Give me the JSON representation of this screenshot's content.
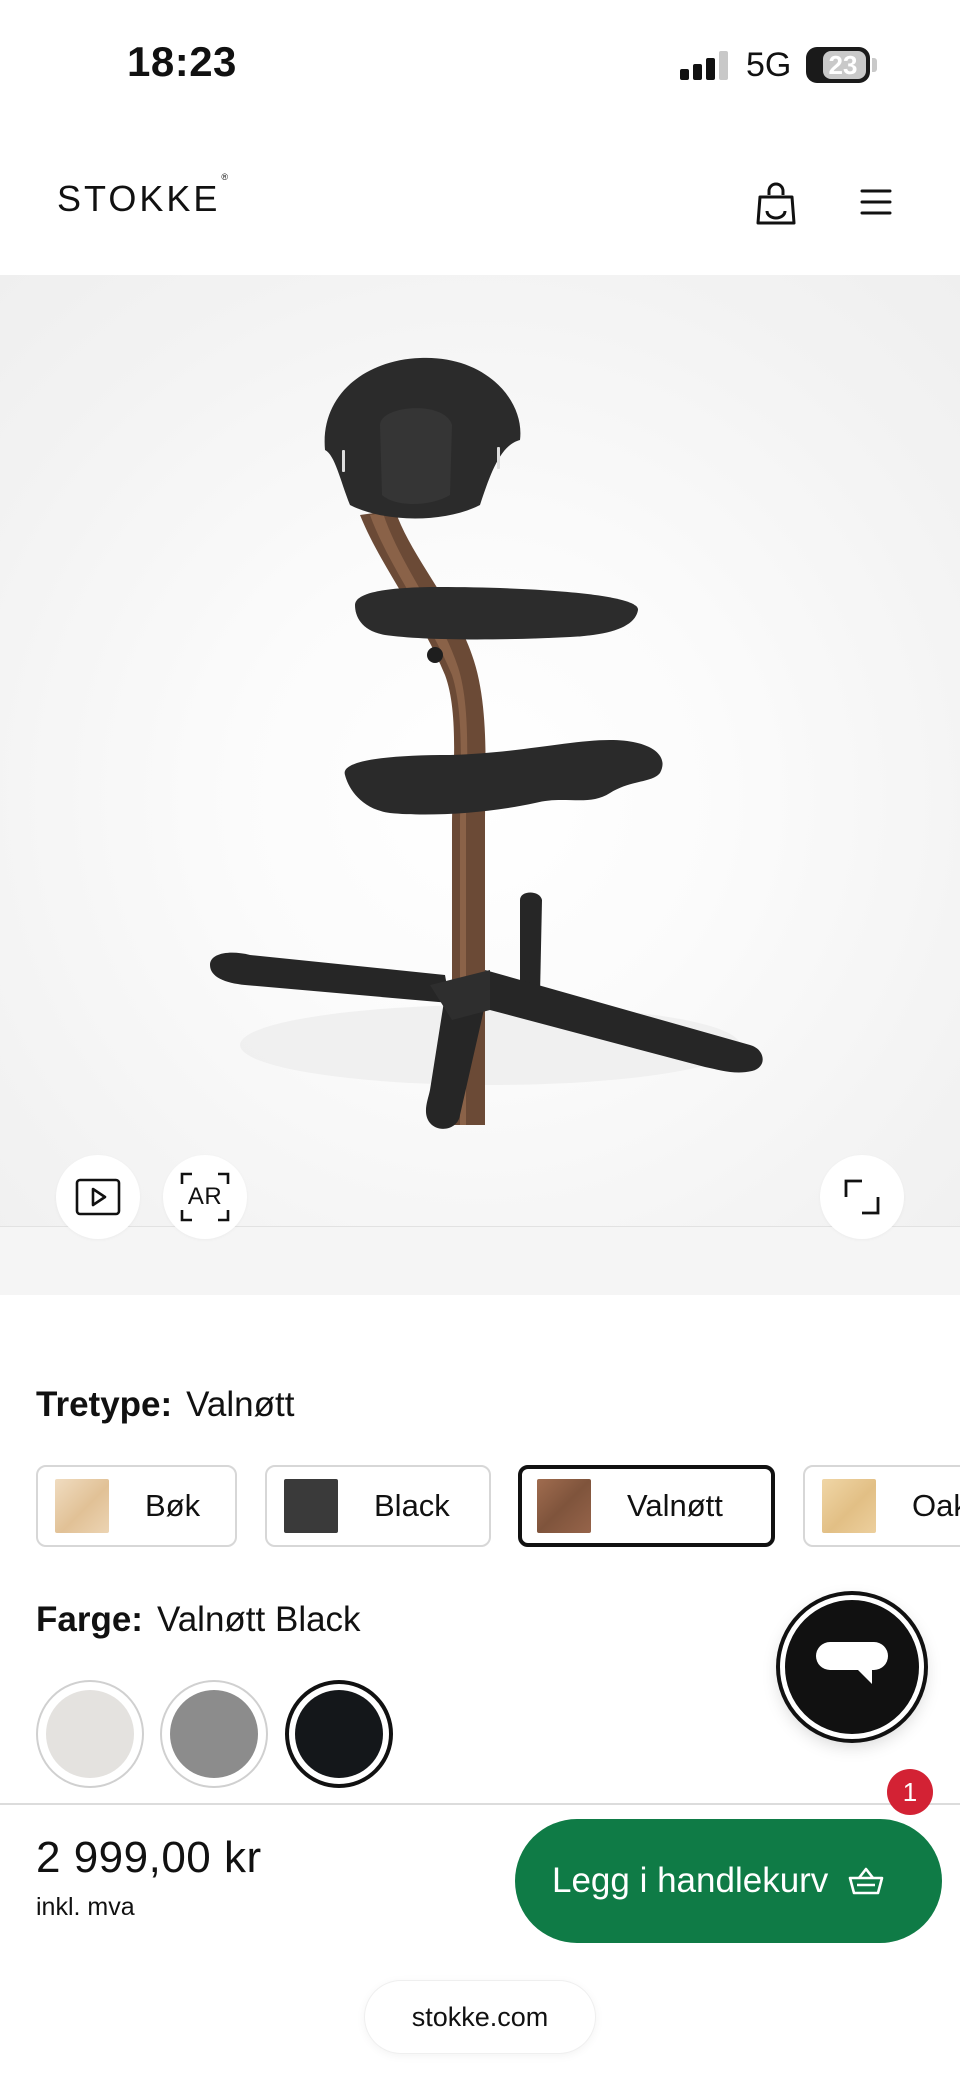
{
  "status_bar": {
    "time": "18:23",
    "network": "5G",
    "battery_level": "23"
  },
  "header": {
    "logo_text": "STOKKE",
    "logo_mark": "®",
    "cart_icon": "shopping-bag-icon",
    "menu_icon": "hamburger-menu-icon"
  },
  "gallery": {
    "video_icon": "play-video-icon",
    "ar_label": "AR",
    "fullscreen_icon": "fullscreen-icon"
  },
  "wood_option": {
    "label": "Tretype:",
    "value": "Valnøtt",
    "swatches": [
      {
        "name": "Bøk",
        "color": "#e6c9a4",
        "selected": false
      },
      {
        "name": "Black",
        "color": "#3a3a3a",
        "selected": false
      },
      {
        "name": "Valnøtt",
        "color": "#8a5a40",
        "selected": true
      },
      {
        "name": "Oak",
        "color": "#e8c891",
        "selected": false
      }
    ]
  },
  "color_option": {
    "label": "Farge:",
    "value": "Valnøtt Black",
    "swatches": [
      {
        "color": "#e4e2df",
        "selected": false
      },
      {
        "color": "#8c8c8c",
        "selected": false
      },
      {
        "color": "#14171a",
        "selected": true
      }
    ]
  },
  "chat": {
    "icon": "chat-bubble-icon"
  },
  "purchase": {
    "price": "2 999,00 kr",
    "vat_note": "inkl. mva",
    "add_to_cart_label": "Legg i handlekurv",
    "cart_icon": "basket-icon",
    "cart_badge": "1",
    "accent_color": "#0f7b46",
    "badge_color": "#d32234"
  },
  "browser": {
    "url": "stokke.com"
  }
}
